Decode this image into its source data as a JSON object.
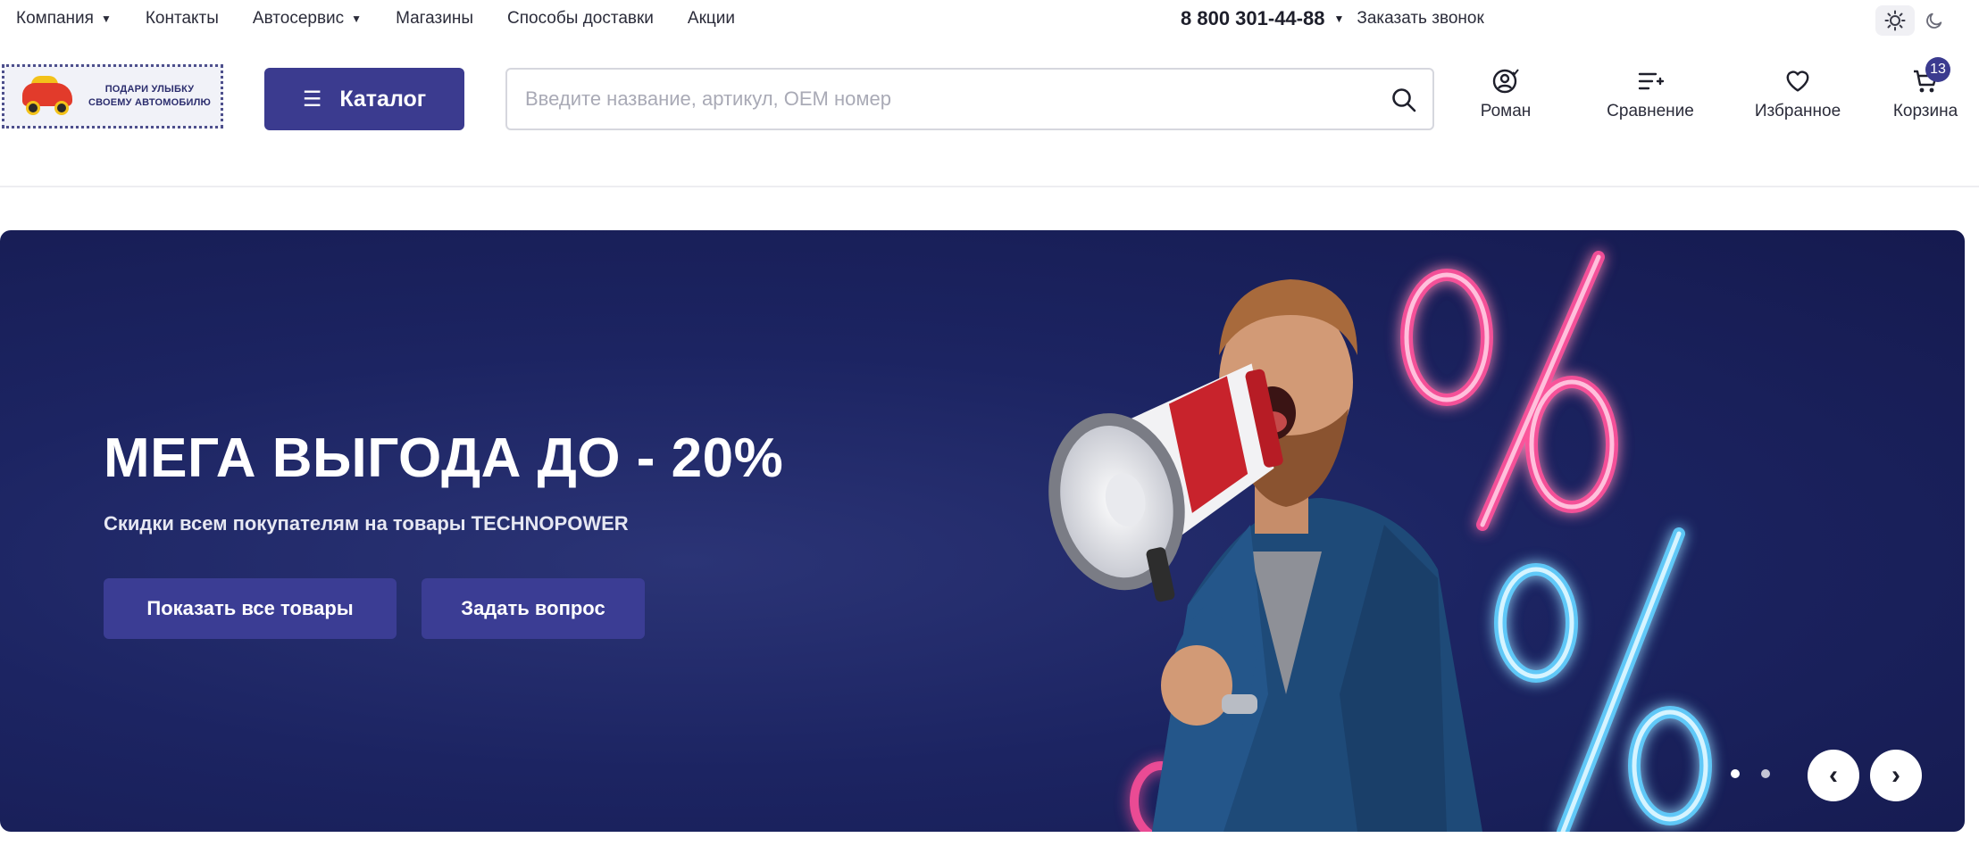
{
  "topnav": {
    "items": [
      {
        "label": "Компания",
        "dropdown": true
      },
      {
        "label": "Контакты",
        "dropdown": false
      },
      {
        "label": "Автосервис",
        "dropdown": true
      },
      {
        "label": "Магазины",
        "dropdown": false
      },
      {
        "label": "Способы доставки",
        "dropdown": false
      },
      {
        "label": "Акции",
        "dropdown": false
      }
    ],
    "phone": "8 800 301-44-88",
    "callback": "Заказать звонок"
  },
  "header": {
    "logo_line1": "ПОДАРИ УЛЫБКУ",
    "logo_line2": "СВОЕМУ АВТОМОБИЛЮ",
    "catalog_label": "Каталог",
    "search_placeholder": "Введите название, артикул, OEM номер",
    "actions": {
      "profile": "Роман",
      "compare": "Сравнение",
      "favorites": "Избранное",
      "cart": "Корзина",
      "cart_count": "13"
    }
  },
  "hero": {
    "title": "МЕГА ВЫГОДА ДО - 20%",
    "subtitle": "Скидки всем покупателям на товары TECHNOPOWER",
    "button_primary": "Показать все товары",
    "button_secondary": "Задать вопрос",
    "slide_count": 2,
    "prev_glyph": "‹",
    "next_glyph": "›"
  },
  "colors": {
    "accent": "#3b3b8f",
    "hero_bg": "#1c2462",
    "neon_pink": "#ff4f9a",
    "neon_blue": "#5fd0ff"
  }
}
